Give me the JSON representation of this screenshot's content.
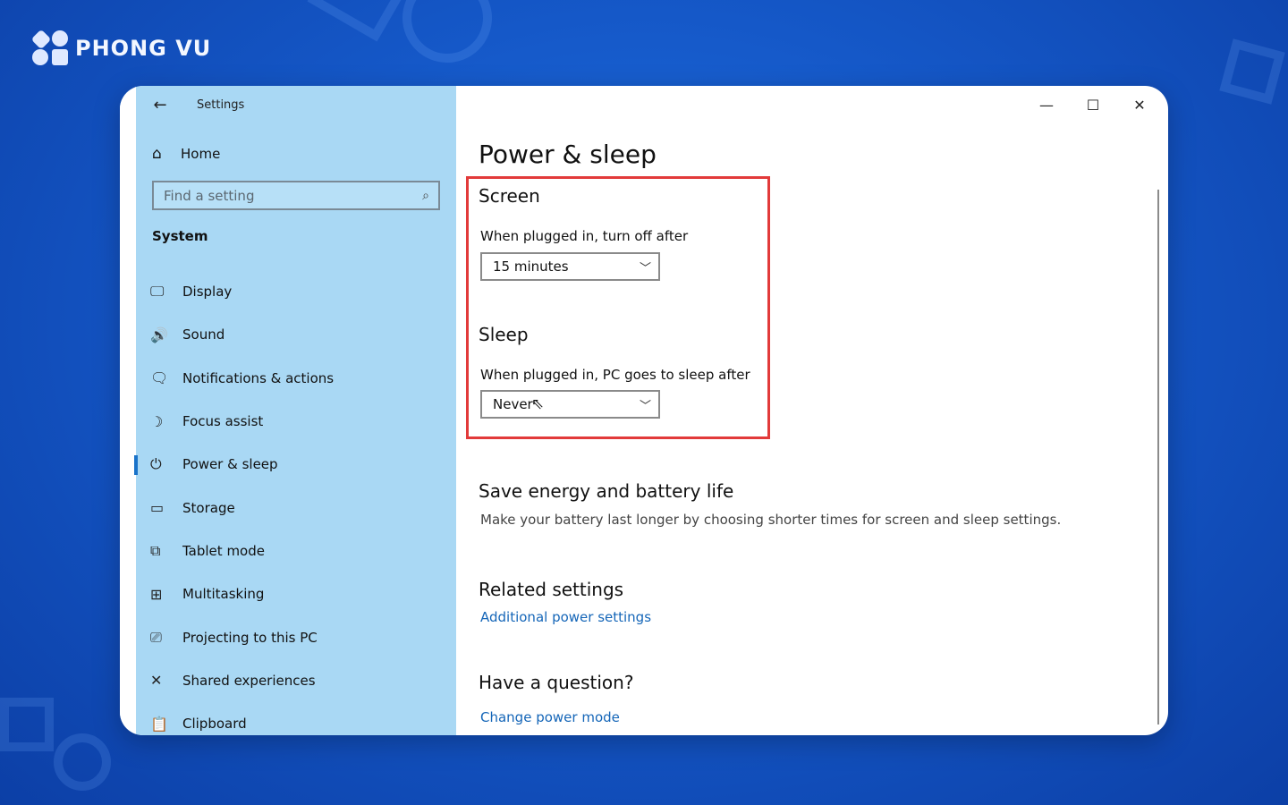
{
  "brand": {
    "name": "PHONG VU"
  },
  "window": {
    "app_title": "Settings",
    "controls": {
      "minimize": "—",
      "maximize": "☐",
      "close": "✕"
    }
  },
  "sidebar": {
    "home_label": "Home",
    "search_placeholder": "Find a setting",
    "section": "System",
    "items": [
      {
        "label": "Display",
        "icon": "monitor-icon",
        "glyph": "🖵"
      },
      {
        "label": "Sound",
        "icon": "speaker-icon",
        "glyph": "🔊"
      },
      {
        "label": "Notifications & actions",
        "icon": "notification-icon",
        "glyph": "🗨"
      },
      {
        "label": "Focus assist",
        "icon": "moon-icon",
        "glyph": "☽"
      },
      {
        "label": "Power & sleep",
        "icon": "power-icon",
        "glyph": "⏻"
      },
      {
        "label": "Storage",
        "icon": "storage-icon",
        "glyph": "▭"
      },
      {
        "label": "Tablet mode",
        "icon": "tablet-icon",
        "glyph": "⧉"
      },
      {
        "label": "Multitasking",
        "icon": "multitasking-icon",
        "glyph": "⊞"
      },
      {
        "label": "Projecting to this PC",
        "icon": "projector-icon",
        "glyph": "⎚"
      },
      {
        "label": "Shared experiences",
        "icon": "shared-icon",
        "glyph": "✕"
      },
      {
        "label": "Clipboard",
        "icon": "clipboard-icon",
        "glyph": "📋"
      }
    ],
    "active_item": "Power & sleep"
  },
  "main": {
    "title": "Power & sleep",
    "screen": {
      "heading": "Screen",
      "label": "When plugged in, turn off after",
      "value": "15 minutes"
    },
    "sleep": {
      "heading": "Sleep",
      "label": "When plugged in, PC goes to sleep after",
      "value": "Never"
    },
    "save_energy": {
      "heading": "Save energy and battery life",
      "text": "Make your battery last longer by choosing shorter times for screen and sleep settings."
    },
    "related": {
      "heading": "Related settings",
      "link": "Additional power settings"
    },
    "question": {
      "heading": "Have a question?",
      "link": "Change power mode"
    }
  },
  "colors": {
    "background": "#1558c8",
    "sidebar": "#a9d8f4",
    "highlight": "#e23a3a",
    "link": "#1566b8",
    "accent": "#1a73c9"
  }
}
